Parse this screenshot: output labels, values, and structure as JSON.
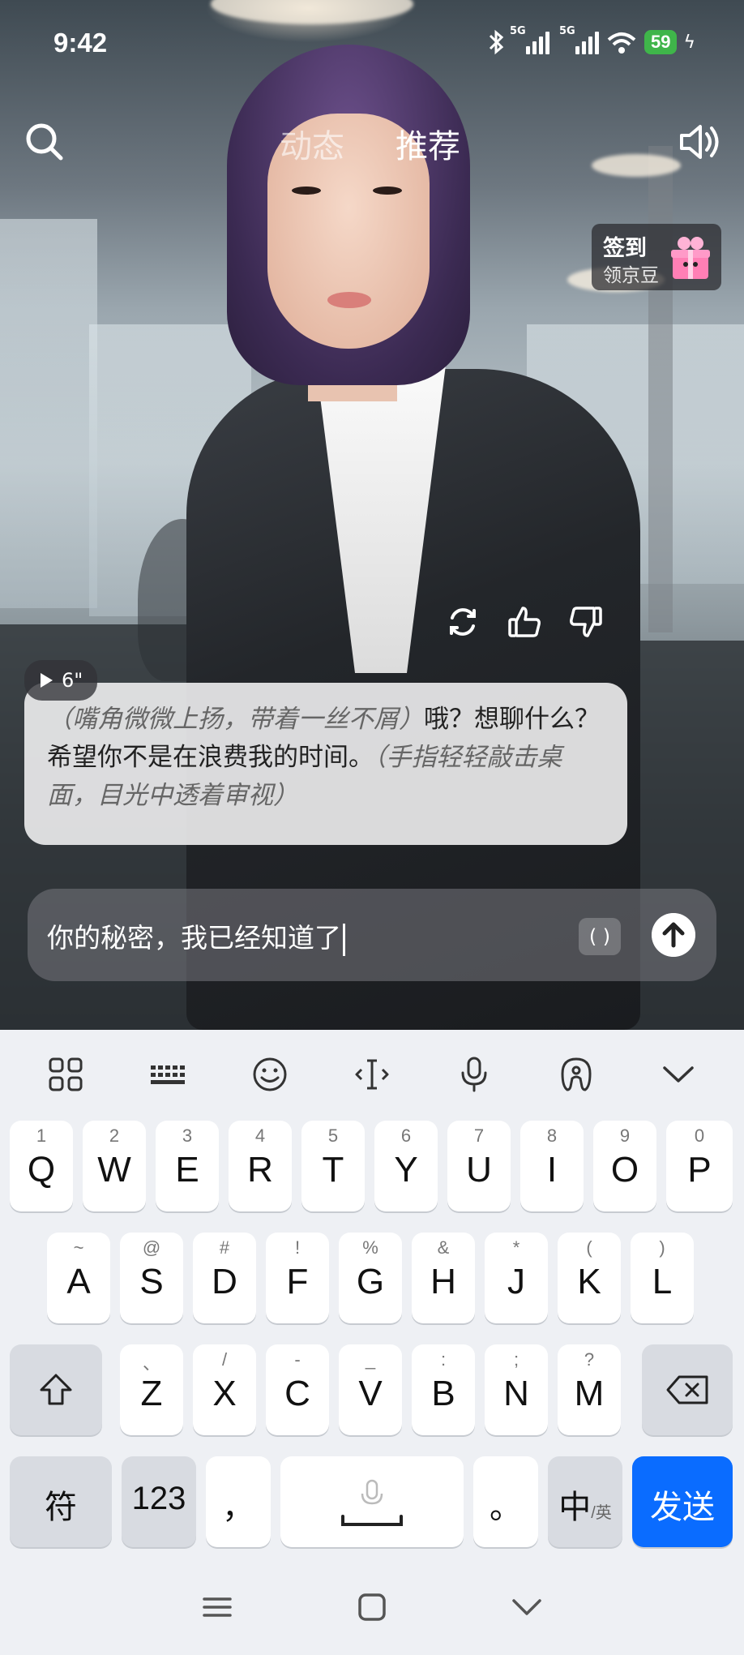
{
  "status_bar": {
    "time": "9:42",
    "network_1": "5G",
    "network_2": "5G",
    "battery": "59"
  },
  "nav": {
    "tabs": [
      {
        "label": "动态",
        "active": false
      },
      {
        "label": "推荐",
        "active": true
      }
    ]
  },
  "checkin": {
    "title": "签到",
    "subtitle": "领京豆"
  },
  "message": {
    "duration": "6\"",
    "action_1": "（嘴角微微上扬，带着一丝不屑）",
    "speech": "哦？想聊什么？希望你不是在浪费我的时间。",
    "action_2": "（手指轻轻敲击桌面，目光中透着审视）"
  },
  "input": {
    "value": "你的秘密，我已经知道了",
    "paren_button": "( )"
  },
  "keyboard": {
    "row1": [
      {
        "main": "Q",
        "sub": "1"
      },
      {
        "main": "W",
        "sub": "2"
      },
      {
        "main": "E",
        "sub": "3"
      },
      {
        "main": "R",
        "sub": "4"
      },
      {
        "main": "T",
        "sub": "5"
      },
      {
        "main": "Y",
        "sub": "6"
      },
      {
        "main": "U",
        "sub": "7"
      },
      {
        "main": "I",
        "sub": "8"
      },
      {
        "main": "O",
        "sub": "9"
      },
      {
        "main": "P",
        "sub": "0"
      }
    ],
    "row2": [
      {
        "main": "A",
        "sub": "~"
      },
      {
        "main": "S",
        "sub": "@"
      },
      {
        "main": "D",
        "sub": "#"
      },
      {
        "main": "F",
        "sub": "!"
      },
      {
        "main": "G",
        "sub": "%"
      },
      {
        "main": "H",
        "sub": "&"
      },
      {
        "main": "J",
        "sub": "*"
      },
      {
        "main": "K",
        "sub": "("
      },
      {
        "main": "L",
        "sub": ")"
      }
    ],
    "row3": [
      {
        "main": "Z",
        "sub": "、"
      },
      {
        "main": "X",
        "sub": "/"
      },
      {
        "main": "C",
        "sub": "-"
      },
      {
        "main": "V",
        "sub": "_"
      },
      {
        "main": "B",
        "sub": ":"
      },
      {
        "main": "N",
        "sub": ";"
      },
      {
        "main": "M",
        "sub": "?"
      }
    ],
    "symbols_label": "符",
    "numbers_label": "123",
    "comma_label": "，",
    "period_label": "。",
    "lang_label_main": "中",
    "lang_label_sub": "/英",
    "send_label": "发送"
  },
  "colors": {
    "send_key": "#0a6cff",
    "battery": "#3fb54a"
  }
}
